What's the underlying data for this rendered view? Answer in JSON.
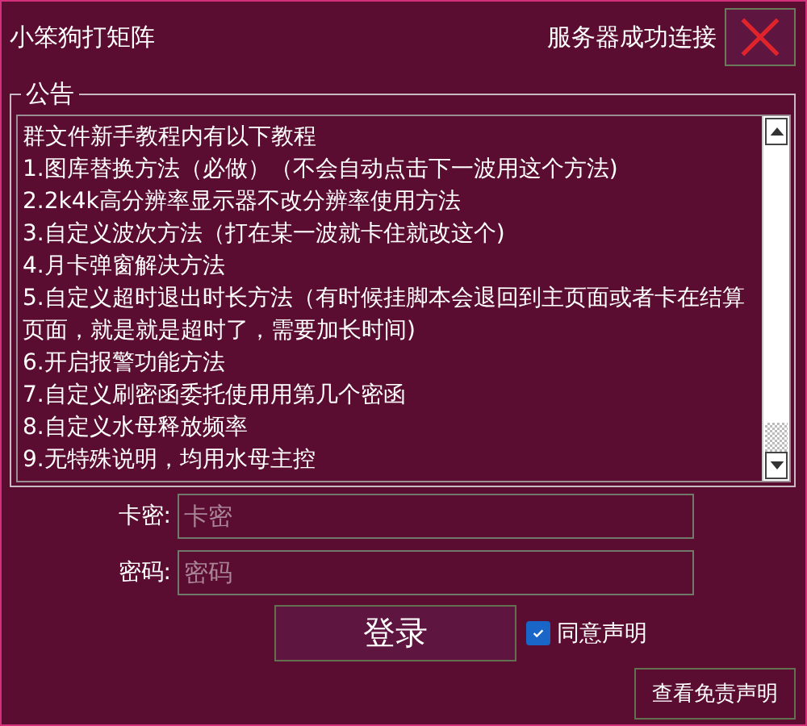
{
  "window": {
    "title": "小笨狗打矩阵",
    "status": "服务器成功连接"
  },
  "notice": {
    "title": "公告",
    "lines": [
      "群文件新手教程内有以下教程",
      "1.图库替换方法（必做）（不会自动点击下一波用这个方法)",
      "2.2k4k高分辨率显示器不改分辨率使用方法",
      "3.自定义波次方法（打在某一波就卡住就改这个)",
      "4.月卡弹窗解决方法",
      "5.自定义超时退出时长方法（有时候挂脚本会退回到主页面或者卡在结算页面，就是就是超时了，需要加长时间)",
      "6.开启报警功能方法",
      "7.自定义刷密函委托使用用第几个密函",
      "8.自定义水母释放频率",
      "9.无特殊说明，均用水母主控"
    ]
  },
  "fields": [
    {
      "label": "卡密:",
      "placeholder": "卡密"
    },
    {
      "label": "密码:",
      "placeholder": "密码"
    }
  ],
  "login_button": "登录",
  "agree": {
    "label": "同意声明",
    "checked": true
  },
  "disclaimer_button": "查看免责声明"
}
